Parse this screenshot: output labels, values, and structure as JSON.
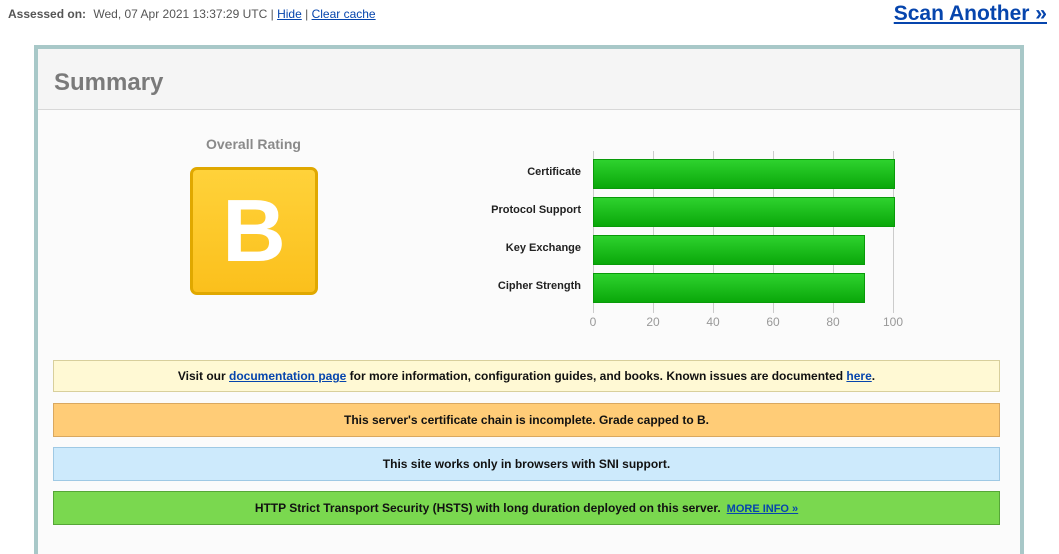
{
  "topbar": {
    "assessed_label": "Assessed on:",
    "assessed_date": "Wed, 07 Apr 2021 13:37:29 UTC",
    "sep1": "|",
    "hide": "Hide",
    "sep2": "|",
    "clear_cache": "Clear cache"
  },
  "scan_another": "Scan Another »",
  "summary": {
    "title": "Summary",
    "overall_label": "Overall Rating",
    "grade": "B"
  },
  "chart_data": {
    "type": "bar",
    "orientation": "horizontal",
    "categories": [
      "Certificate",
      "Protocol Support",
      "Key Exchange",
      "Cipher Strength"
    ],
    "values": [
      100,
      100,
      90,
      90
    ],
    "xlim": [
      0,
      100
    ],
    "ticks": [
      "0",
      "20",
      "40",
      "60",
      "80",
      "100"
    ],
    "grid": true,
    "bar_color": "#1ec41e"
  },
  "messages": {
    "info_pre": "Visit our ",
    "info_link1": "documentation page",
    "info_mid": " for more information, configuration guides, and books. Known issues are documented ",
    "info_link2": "here",
    "info_post": ".",
    "warn": "This server's certificate chain is incomplete. Grade capped to B.",
    "sni": "This site works only in browsers with SNI support.",
    "hsts": "HTTP Strict Transport Security (HSTS) with long duration deployed on this server.",
    "hsts_more": "MORE INFO »"
  },
  "colors": {
    "grade_bg": "#fbc01c",
    "info_bg": "#fff9d4",
    "warn_bg": "#ffcc77",
    "sni_bg": "#cdeafc",
    "hsts_bg": "#7ad84f",
    "link": "#0645ad"
  }
}
